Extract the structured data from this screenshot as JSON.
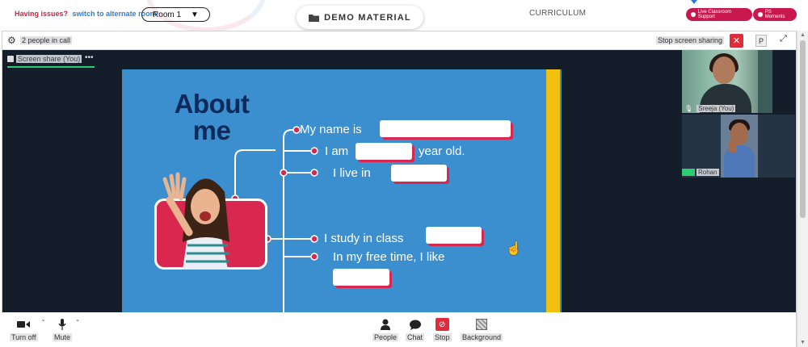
{
  "topbar": {
    "issues_label": "Having issues?",
    "switch_label": "switch to alternate room",
    "room_select": "Room 1",
    "demo_material": "DEMO MATERIAL",
    "curriculum": "CURRICULUM",
    "live_support": "Live Classroom Support",
    "ps_moments": "PS Moments"
  },
  "call": {
    "people_count": "2 people in call",
    "stop_sharing": "Stop screen sharing",
    "p_button": "P",
    "tab_label": "Screen share (You)",
    "tab_more": "•••"
  },
  "slide": {
    "title": "About me",
    "line1": "My name is",
    "line2_pre": "I am",
    "line2_post": "year old.",
    "line3": "I live in",
    "line4": "I study in class",
    "line5": "In my free time, I like"
  },
  "participants": [
    {
      "name": "Sreeja (You)"
    },
    {
      "name": "Rohan"
    }
  ],
  "toolbar": {
    "turn_off": "Turn off",
    "mute": "Mute",
    "people": "People",
    "chat": "Chat",
    "stop": "Stop",
    "background": "Background"
  },
  "colors": {
    "accent_red": "#d2214a",
    "link_blue": "#2b7fd1",
    "slide_blue": "#3b8fcf",
    "slide_yellow": "#f2c00f",
    "title_navy": "#0e2a5a",
    "live_green": "#2ecc71"
  }
}
